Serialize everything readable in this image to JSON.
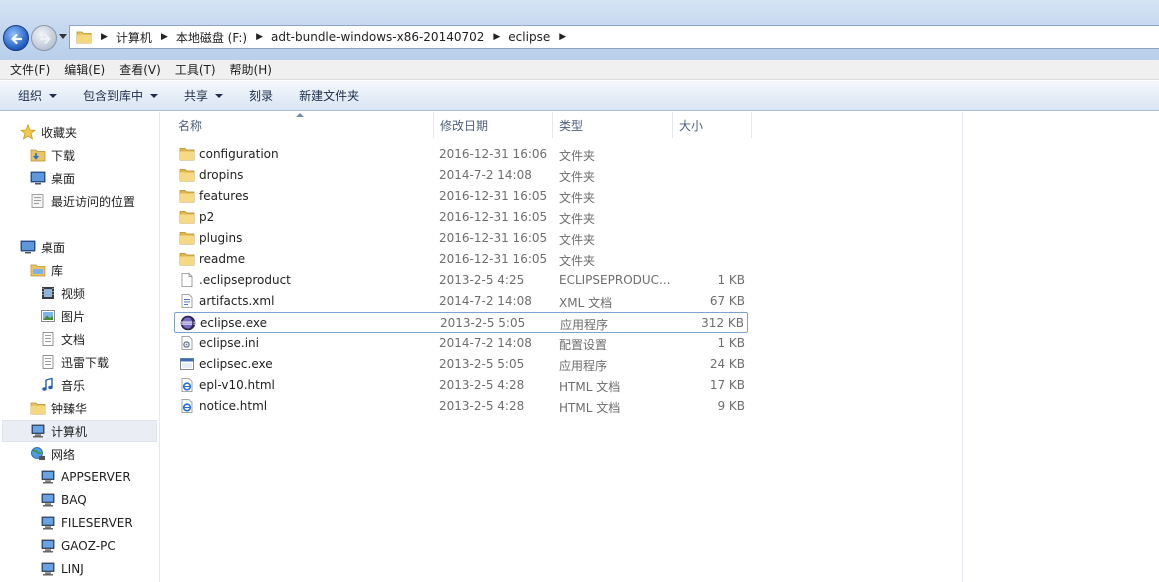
{
  "address": {
    "crumbs": [
      "计算机",
      "本地磁盘 (F:)",
      "adt-bundle-windows-x86-20140702",
      "eclipse"
    ]
  },
  "menu": [
    "文件(F)",
    "编辑(E)",
    "查看(V)",
    "工具(T)",
    "帮助(H)"
  ],
  "toolbar": {
    "organize": "组织",
    "include_library": "包含到库中",
    "share": "共享",
    "burn": "刻录",
    "new_folder": "新建文件夹"
  },
  "nav": {
    "favorites": "收藏夹",
    "downloads": "下载",
    "desktop_fav": "桌面",
    "recent": "最近访问的位置",
    "desktop": "桌面",
    "libraries": "库",
    "videos": "视频",
    "pictures": "图片",
    "documents": "文档",
    "thunder": "迅雷下载",
    "music": "音乐",
    "user": "钟臻华",
    "computer": "计算机",
    "network": "网络",
    "net_hosts": [
      "APPSERVER",
      "BAQ",
      "FILESERVER",
      "GAOZ-PC",
      "LINJ"
    ]
  },
  "columns": {
    "name": "名称",
    "date": "修改日期",
    "type": "类型",
    "size": "大小"
  },
  "files": [
    {
      "name": "configuration",
      "date": "2016-12-31 16:06",
      "type": "文件夹",
      "size": "",
      "icon": "folder-icon"
    },
    {
      "name": "dropins",
      "date": "2014-7-2 14:08",
      "type": "文件夹",
      "size": "",
      "icon": "folder-icon"
    },
    {
      "name": "features",
      "date": "2016-12-31 16:05",
      "type": "文件夹",
      "size": "",
      "icon": "folder-icon"
    },
    {
      "name": "p2",
      "date": "2016-12-31 16:05",
      "type": "文件夹",
      "size": "",
      "icon": "folder-icon"
    },
    {
      "name": "plugins",
      "date": "2016-12-31 16:05",
      "type": "文件夹",
      "size": "",
      "icon": "folder-icon"
    },
    {
      "name": "readme",
      "date": "2016-12-31 16:05",
      "type": "文件夹",
      "size": "",
      "icon": "folder-icon"
    },
    {
      "name": ".eclipseproduct",
      "date": "2013-2-5 4:25",
      "type": "ECLIPSEPRODUC...",
      "size": "1 KB",
      "icon": "blank-file-icon"
    },
    {
      "name": "artifacts.xml",
      "date": "2014-7-2 14:08",
      "type": "XML 文档",
      "size": "67 KB",
      "icon": "xml-file-icon"
    },
    {
      "name": "eclipse.exe",
      "date": "2013-2-5 5:05",
      "type": "应用程序",
      "size": "312 KB",
      "icon": "eclipse-icon"
    },
    {
      "name": "eclipse.ini",
      "date": "2014-7-2 14:08",
      "type": "配置设置",
      "size": "1 KB",
      "icon": "ini-file-icon"
    },
    {
      "name": "eclipsec.exe",
      "date": "2013-2-5 5:05",
      "type": "应用程序",
      "size": "24 KB",
      "icon": "exe-window-icon"
    },
    {
      "name": "epl-v10.html",
      "date": "2013-2-5 4:28",
      "type": "HTML 文档",
      "size": "17 KB",
      "icon": "ie-html-icon"
    },
    {
      "name": "notice.html",
      "date": "2013-2-5 4:28",
      "type": "HTML 文档",
      "size": "9 KB",
      "icon": "ie-html-icon"
    }
  ],
  "selected_file": "eclipse.exe"
}
